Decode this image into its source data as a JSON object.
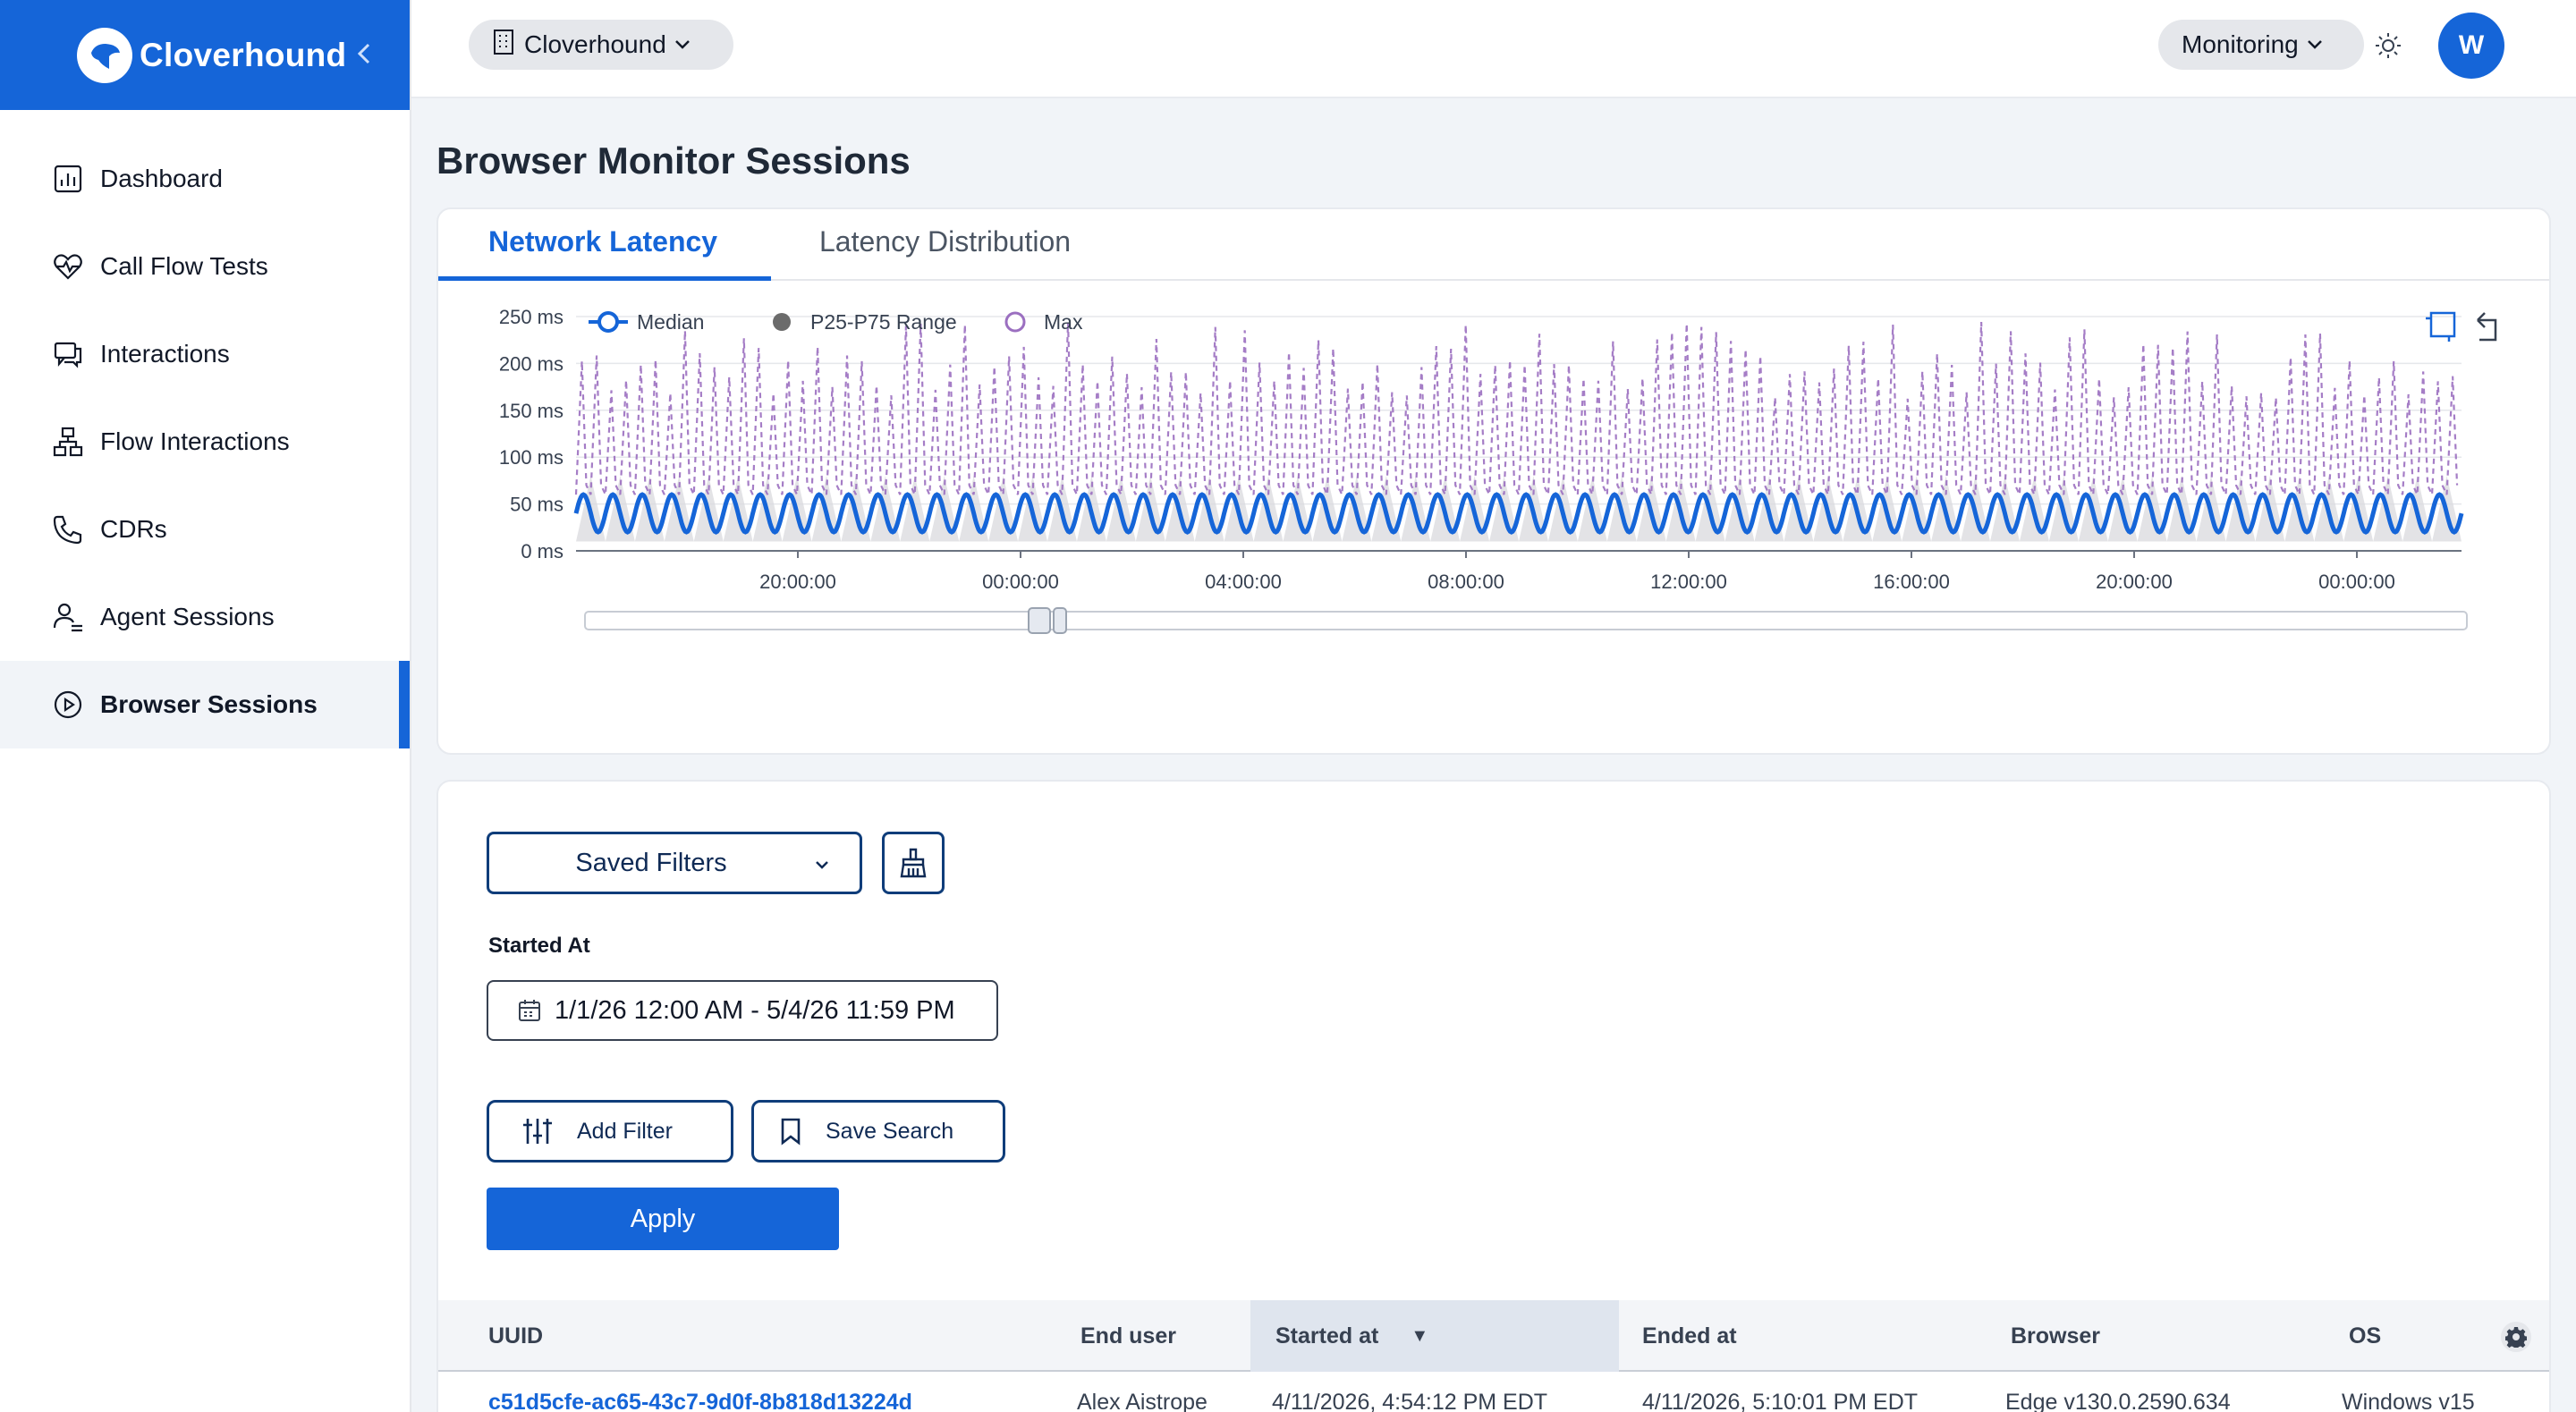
{
  "sidebar": {
    "brand": "Cloverhound",
    "items": [
      {
        "label": "Dashboard",
        "icon": "chart-icon"
      },
      {
        "label": "Call Flow Tests",
        "icon": "heart-pulse-icon"
      },
      {
        "label": "Interactions",
        "icon": "chat-icon"
      },
      {
        "label": "Flow Interactions",
        "icon": "flow-icon"
      },
      {
        "label": "CDRs",
        "icon": "phone-icon"
      },
      {
        "label": "Agent Sessions",
        "icon": "agent-icon"
      },
      {
        "label": "Browser Sessions",
        "icon": "play-circle-icon"
      }
    ],
    "active_index": 6
  },
  "topbar": {
    "org": "Cloverhound",
    "module": "Monitoring",
    "avatar_initial": "W"
  },
  "page": {
    "title": "Browser Monitor Sessions"
  },
  "tabs": [
    {
      "label": "Network Latency",
      "active": true
    },
    {
      "label": "Latency Distribution",
      "active": false
    }
  ],
  "chart_data": {
    "type": "line",
    "title": "",
    "y_ticks": [
      "0 ms",
      "50 ms",
      "100 ms",
      "150 ms",
      "200 ms",
      "250 ms"
    ],
    "ylim": [
      0,
      250
    ],
    "x_ticks": [
      "20:00:00",
      "00:00:00",
      "04:00:00",
      "08:00:00",
      "12:00:00",
      "16:00:00",
      "20:00:00",
      "00:00:00"
    ],
    "legend": [
      "Median",
      "P25-P75 Range",
      "Max"
    ],
    "legend_position": "top-left",
    "series": [
      {
        "name": "Median",
        "color": "#1565d8",
        "min": 20,
        "max": 60,
        "cycles": 64
      },
      {
        "name": "P25-P75 Range",
        "color": "#d9dadd",
        "min": 10,
        "max": 80,
        "cycles": 64
      },
      {
        "name": "Max",
        "color": "#9b6fc0",
        "min": 60,
        "max": 245,
        "cycles": 64
      }
    ],
    "colors": {
      "median": "#1565d8",
      "range": "#d9dadd",
      "max": "#9b6fc0"
    }
  },
  "filters": {
    "saved_filters_label": "Saved Filters",
    "started_at_label": "Started At",
    "date_range": "1/1/26 12:00 AM - 5/4/26 11:59 PM",
    "add_filter_label": "Add Filter",
    "save_search_label": "Save Search",
    "apply_label": "Apply"
  },
  "table": {
    "columns": [
      "UUID",
      "End user",
      "Started at",
      "Ended at",
      "Browser",
      "OS"
    ],
    "sorted_column": "Started at",
    "sort_indicator": "▼",
    "rows": [
      [
        "c51d5cfe-ac65-43c7-9d0f-8b818d13224d",
        "Alex Aistrope",
        "4/11/2026, 4:54:12 PM EDT",
        "4/11/2026, 5:10:01 PM EDT",
        "Edge v130.0.2590.634",
        "Windows v15"
      ]
    ]
  }
}
